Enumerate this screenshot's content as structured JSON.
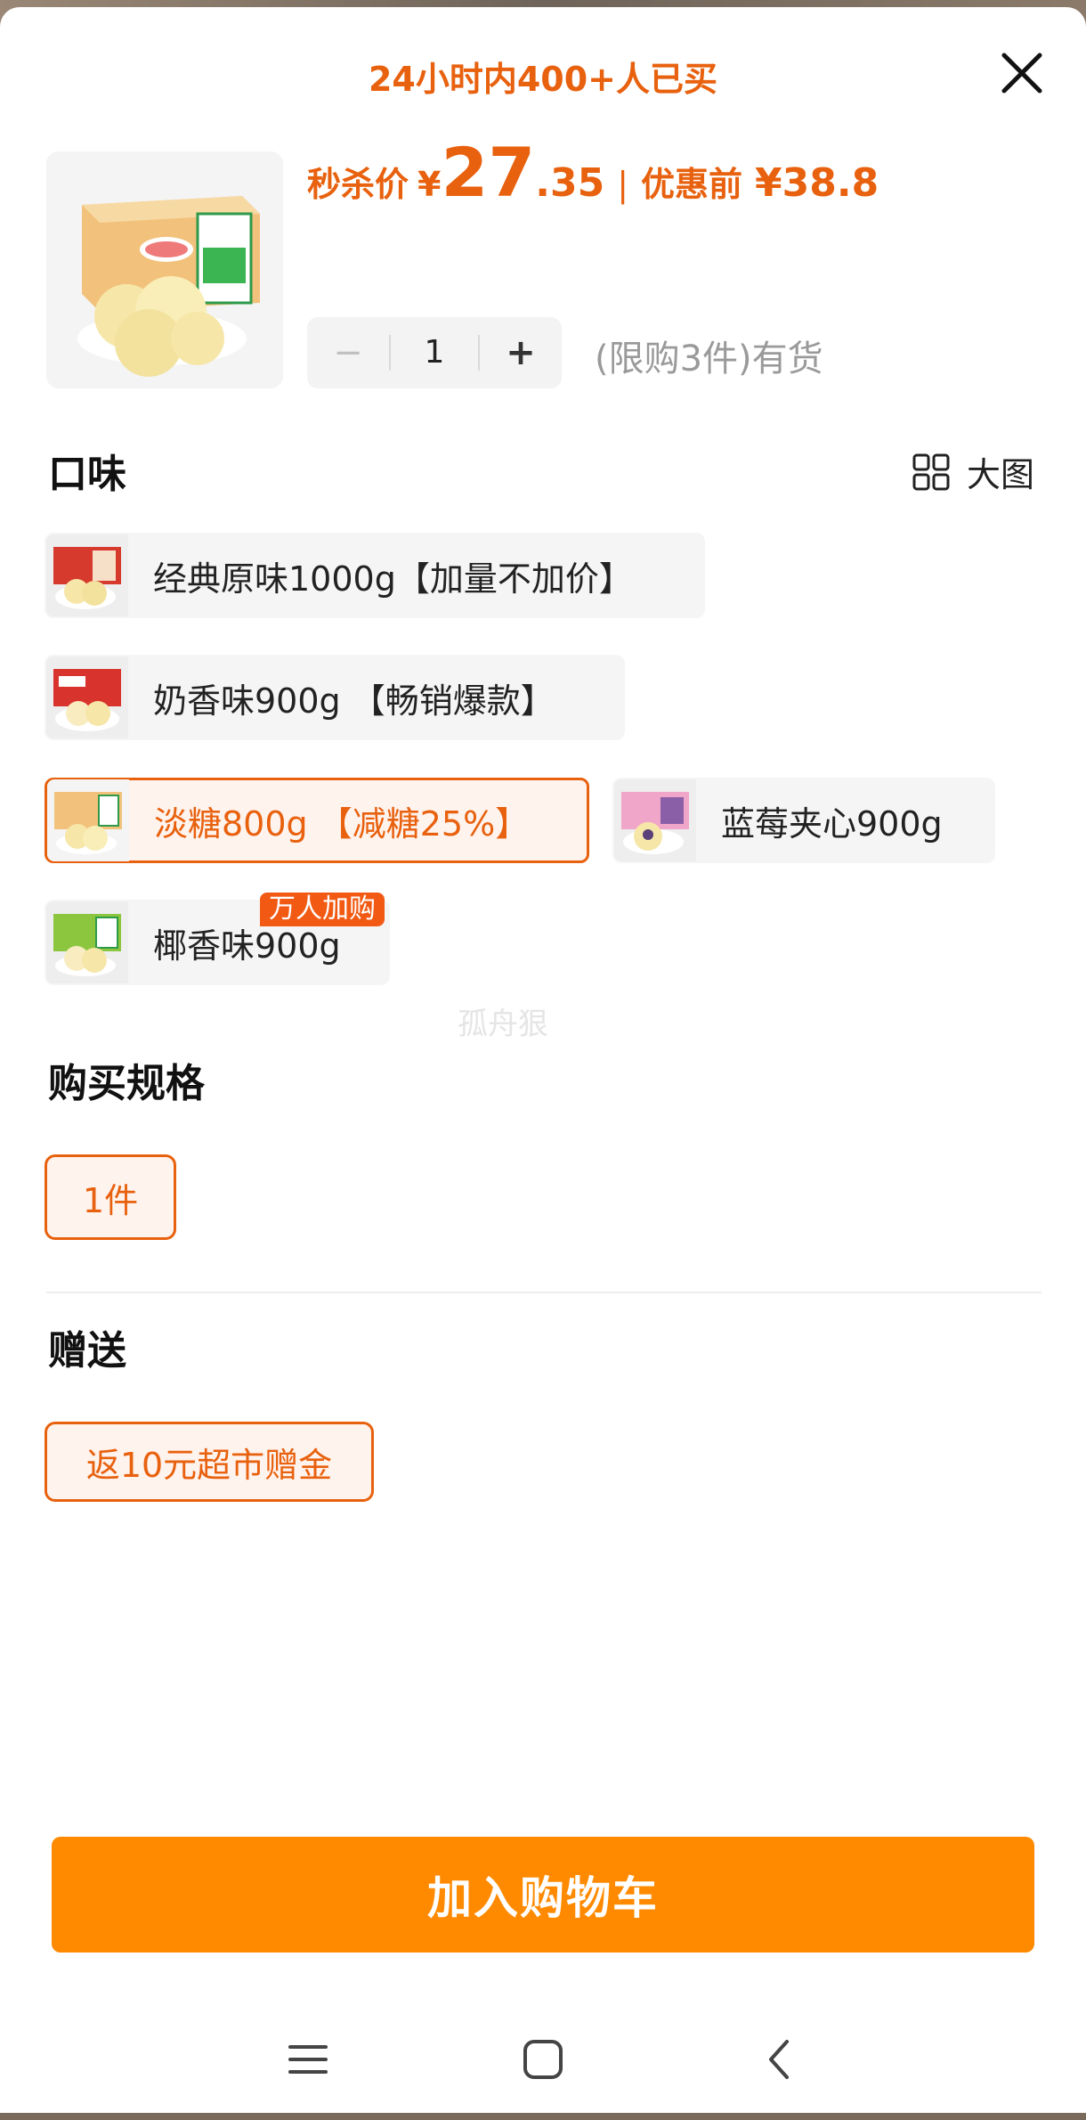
{
  "header": {
    "sold_text": "24小时内400+人已买",
    "close_icon": "close-icon"
  },
  "product": {
    "image_icon": "bread-box-image",
    "price_label": "秒杀价",
    "currency": "¥",
    "price_int": "27",
    "price_dec": ".35",
    "separator": "|",
    "orig_label": "优惠前",
    "orig_price": "¥38.8"
  },
  "quantity": {
    "minus": "−",
    "value": "1",
    "plus": "+",
    "stock_text": "(限购3件)有货"
  },
  "flavor": {
    "title": "口味",
    "big_image_label": "大图",
    "options": [
      {
        "label": "经典原味1000g【加量不加价】",
        "color": "#d63a2c",
        "selected": false
      },
      {
        "label": "奶香味900g 【畅销爆款】",
        "color": "#d8342d",
        "selected": false
      },
      {
        "label": "淡糖800g 【减糖25%】",
        "color": "#e9a24a",
        "selected": true
      },
      {
        "label": "蓝莓夹心900g",
        "color": "#d77fb0",
        "selected": false
      },
      {
        "label": "椰香味900g",
        "color": "#8cc63f",
        "selected": false
      }
    ],
    "hot_tag": "万人加购"
  },
  "watermark": "孤舟狠",
  "spec": {
    "title": "购买规格",
    "option": "1件"
  },
  "gift": {
    "title": "赠送",
    "option": "返10元超市赠金"
  },
  "cart_button": "加入购物车",
  "colors": {
    "accent": "#e8610e",
    "button": "#ff8a00"
  }
}
